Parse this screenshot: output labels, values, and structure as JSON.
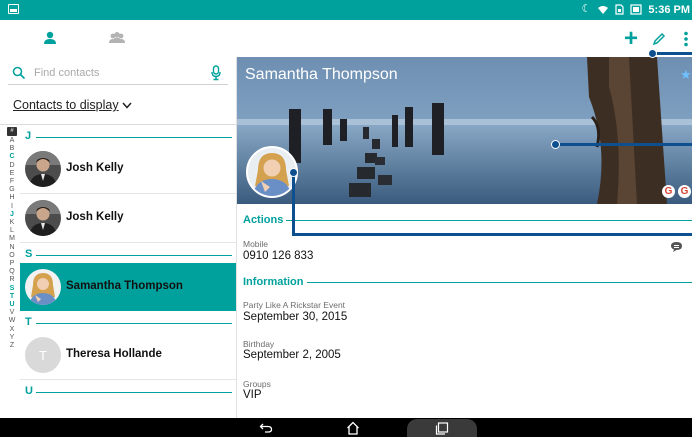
{
  "status_bar": {
    "time": "5:36 PM"
  },
  "top_bar": {
    "tabs": [
      {
        "name": "person-tab",
        "icon": "person-icon",
        "active": true
      },
      {
        "name": "groups-tab",
        "icon": "groups-icon",
        "active": false
      }
    ],
    "actions": [
      {
        "icon": "add-icon",
        "label": "+"
      },
      {
        "icon": "edit-icon"
      },
      {
        "icon": "more-vert-icon"
      }
    ]
  },
  "sidebar": {
    "search_placeholder": "Find contacts",
    "contacts_to_display": "Contacts to display",
    "alpha_index": [
      "#",
      "A",
      "B",
      "C",
      "D",
      "E",
      "F",
      "G",
      "H",
      "I",
      "J",
      "K",
      "L",
      "M",
      "N",
      "O",
      "P",
      "Q",
      "R",
      "S",
      "T",
      "U",
      "V",
      "W",
      "X",
      "Y",
      "Z"
    ],
    "highlighted_letters": [
      "C",
      "J",
      "S",
      "T",
      "U"
    ],
    "sections": [
      {
        "letter": "J",
        "contacts": [
          {
            "name": "Josh Kelly",
            "avatar": "photo",
            "selected": false
          },
          {
            "name": "Josh Kelly",
            "avatar": "photo",
            "selected": false
          }
        ]
      },
      {
        "letter": "S",
        "contacts": [
          {
            "name": "Samantha Thompson",
            "avatar": "photo",
            "selected": true
          }
        ]
      },
      {
        "letter": "T",
        "contacts": [
          {
            "name": "Theresa Hollande",
            "avatar": "T",
            "selected": false
          }
        ]
      },
      {
        "letter": "U",
        "contacts": []
      }
    ]
  },
  "detail": {
    "name": "Samantha Thompson",
    "starred": true,
    "badges": [
      "G",
      "G"
    ],
    "actions_header": "Actions",
    "mobile_label": "Mobile",
    "mobile_value": "0910 126 833",
    "information_header": "Information",
    "event_label": "Party Like A Rickstar Event",
    "event_value": "September 30, 2015",
    "birthday_label": "Birthday",
    "birthday_value": "September 2, 2005",
    "groups_label": "Groups",
    "groups_value": "VIP"
  },
  "colors": {
    "accent": "#00a19c",
    "callout": "#0d4f8f"
  }
}
